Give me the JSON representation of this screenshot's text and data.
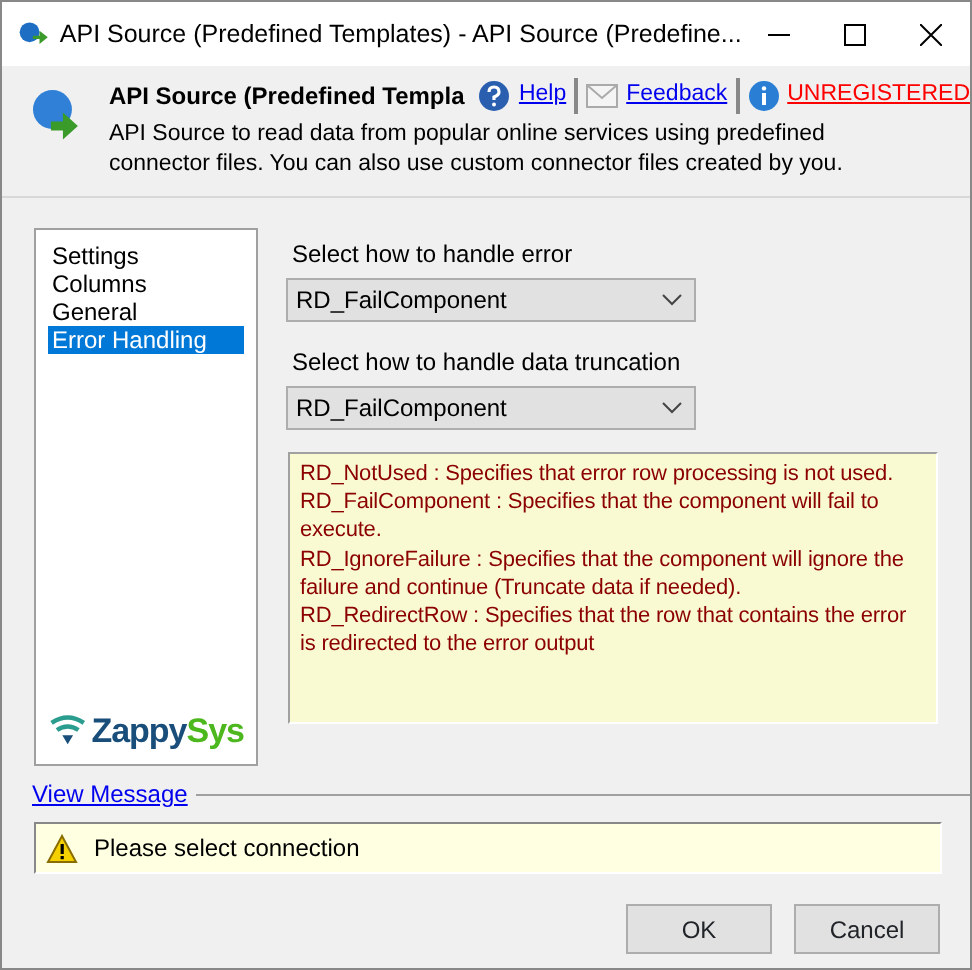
{
  "window": {
    "title": "API Source (Predefined Templates) - API Source (Predefine..."
  },
  "header": {
    "title": "API Source (Predefined Templa",
    "links": [
      {
        "kind": "help",
        "label": "Help"
      },
      {
        "kind": "feedback",
        "label": "Feedback"
      },
      {
        "kind": "info",
        "label": "UNREGISTERED"
      }
    ],
    "description": "API Source to read data from popular online services using predefined connector files. You can also use custom connector files created by you."
  },
  "sidebar": {
    "items": [
      {
        "label": "Settings",
        "selected": false
      },
      {
        "label": "Columns",
        "selected": false
      },
      {
        "label": "General",
        "selected": false
      },
      {
        "label": "Error Handling",
        "selected": true
      }
    ],
    "logo": {
      "part_1": "Zappy",
      "part_2": "Sys"
    }
  },
  "fields": [
    {
      "label": "Select how to handle error",
      "value": "RD_FailComponent"
    },
    {
      "label": "Select how to handle data truncation",
      "value": "RD_FailComponent"
    }
  ],
  "help_lines": [
    "RD_NotUsed : Specifies that error row processing is not used.",
    "RD_FailComponent : Specifies that the component will fail to execute.",
    "RD_IgnoreFailure : Specifies that the component will ignore the failure and continue (Truncate data if needed).",
    "RD_RedirectRow : Specifies that the row that contains the error is redirected to the error output"
  ],
  "message": {
    "link": "View Message",
    "text": "Please select connection"
  },
  "buttons": [
    "OK",
    "Cancel"
  ]
}
